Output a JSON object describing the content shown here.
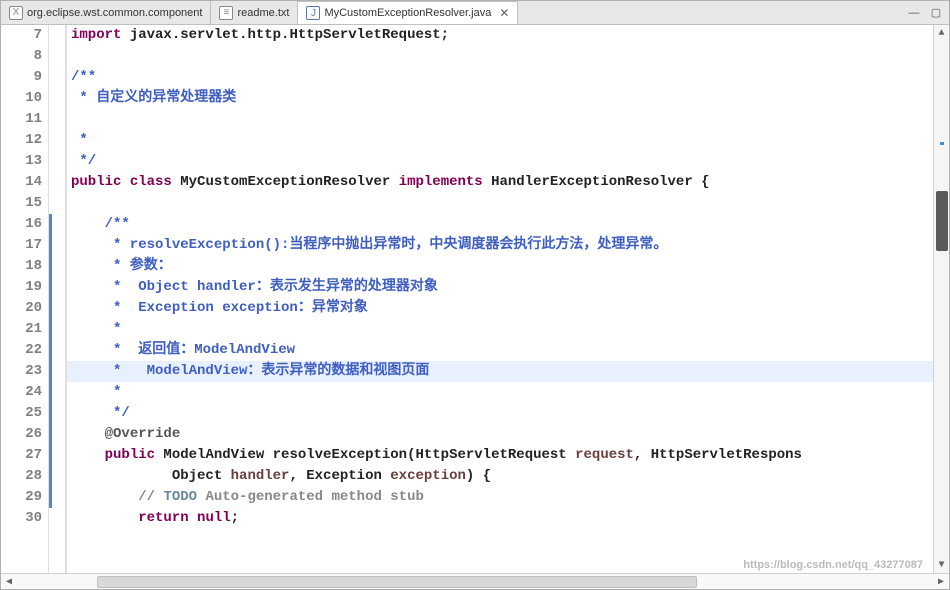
{
  "tabs": [
    {
      "label": "org.eclipse.wst.common.component",
      "icon": "X",
      "iconClass": "xml",
      "active": false
    },
    {
      "label": "readme.txt",
      "icon": "≡",
      "iconClass": "txt",
      "active": false
    },
    {
      "label": "MyCustomExceptionResolver.java",
      "icon": "J",
      "iconClass": "java",
      "active": true
    }
  ],
  "tabbar": {
    "close": "✕",
    "maximize": "▢",
    "minimize": "—"
  },
  "lines": {
    "start": 7,
    "rows": [
      {
        "n": 7,
        "kind": "plain",
        "frags": [
          {
            "cls": "kw",
            "t": "import"
          },
          {
            "cls": "txt",
            "t": " javax.servlet.http.HttpServletRequest;"
          }
        ]
      },
      {
        "n": 8,
        "kind": "plain",
        "frags": []
      },
      {
        "n": 9,
        "kind": "javadoc",
        "text": "/**"
      },
      {
        "n": 10,
        "kind": "javadoc",
        "text": " * 自定义的异常处理器类"
      },
      {
        "n": 11,
        "kind": "javadoc",
        "text": ""
      },
      {
        "n": 12,
        "kind": "javadoc",
        "text": " *"
      },
      {
        "n": 13,
        "kind": "javadoc",
        "text": " */"
      },
      {
        "n": 14,
        "kind": "plain",
        "frags": [
          {
            "cls": "kw",
            "t": "public"
          },
          {
            "cls": "txt",
            "t": " "
          },
          {
            "cls": "kw",
            "t": "class"
          },
          {
            "cls": "txt",
            "t": " MyCustomExceptionResolver "
          },
          {
            "cls": "kw",
            "t": "implements"
          },
          {
            "cls": "txt",
            "t": " HandlerExceptionResolver {"
          }
        ]
      },
      {
        "n": 15,
        "kind": "plain",
        "frags": []
      },
      {
        "n": 16,
        "kind": "javadoc",
        "indent": "    ",
        "text": "/**",
        "mark": true
      },
      {
        "n": 17,
        "kind": "javadoc",
        "indent": "    ",
        "text": " * resolveException():当程序中抛出异常时，中央调度器会执行此方法，处理异常。",
        "mark": true
      },
      {
        "n": 18,
        "kind": "javadoc",
        "indent": "    ",
        "text": " * 参数：",
        "mark": true
      },
      {
        "n": 19,
        "kind": "javadoc",
        "indent": "    ",
        "text": " *  Object handler：表示发生异常的处理器对象",
        "mark": true
      },
      {
        "n": 20,
        "kind": "javadoc",
        "indent": "    ",
        "text": " *  Exception exception：异常对象",
        "mark": true
      },
      {
        "n": 21,
        "kind": "javadoc",
        "indent": "    ",
        "text": " *",
        "mark": true
      },
      {
        "n": 22,
        "kind": "javadoc",
        "indent": "    ",
        "text": " *  返回值：ModelAndView",
        "mark": true
      },
      {
        "n": 23,
        "kind": "javadoc",
        "indent": "    ",
        "text": " *   ModelAndView：表示异常的数据和视图页面",
        "mark": true,
        "hl": true
      },
      {
        "n": 24,
        "kind": "javadoc",
        "indent": "    ",
        "text": " *",
        "mark": true
      },
      {
        "n": 25,
        "kind": "javadoc",
        "indent": "    ",
        "text": " */",
        "mark": true
      },
      {
        "n": 26,
        "kind": "plain",
        "indent": "    ",
        "mark": true,
        "frags": [
          {
            "cls": "ann",
            "t": "@Override"
          }
        ]
      },
      {
        "n": 27,
        "kind": "plain",
        "indent": "    ",
        "mark": true,
        "frags": [
          {
            "cls": "kw",
            "t": "public"
          },
          {
            "cls": "txt",
            "t": " ModelAndView resolveException(HttpServletRequest "
          },
          {
            "cls": "param",
            "t": "request"
          },
          {
            "cls": "txt",
            "t": ", HttpServletRespons"
          }
        ]
      },
      {
        "n": 28,
        "kind": "plain",
        "indent": "            ",
        "mark": true,
        "frags": [
          {
            "cls": "txt",
            "t": "Object "
          },
          {
            "cls": "param",
            "t": "handler"
          },
          {
            "cls": "txt",
            "t": ", Exception "
          },
          {
            "cls": "param",
            "t": "exception"
          },
          {
            "cls": "txt",
            "t": ") {"
          }
        ]
      },
      {
        "n": 29,
        "kind": "comment",
        "indent": "        ",
        "mark": true,
        "frags": [
          {
            "cls": "comment",
            "t": "// "
          },
          {
            "cls": "todo",
            "t": "TODO"
          },
          {
            "cls": "comment",
            "t": " Auto-generated method stub"
          }
        ]
      },
      {
        "n": 30,
        "kind": "plain",
        "indent": "        ",
        "frags": [
          {
            "cls": "kw",
            "t": "return"
          },
          {
            "cls": "txt",
            "t": " "
          },
          {
            "cls": "kw",
            "t": "null"
          },
          {
            "cls": "txt",
            "t": ";"
          }
        ]
      }
    ]
  },
  "watermark": "https://blog.csdn.net/qq_43277087"
}
